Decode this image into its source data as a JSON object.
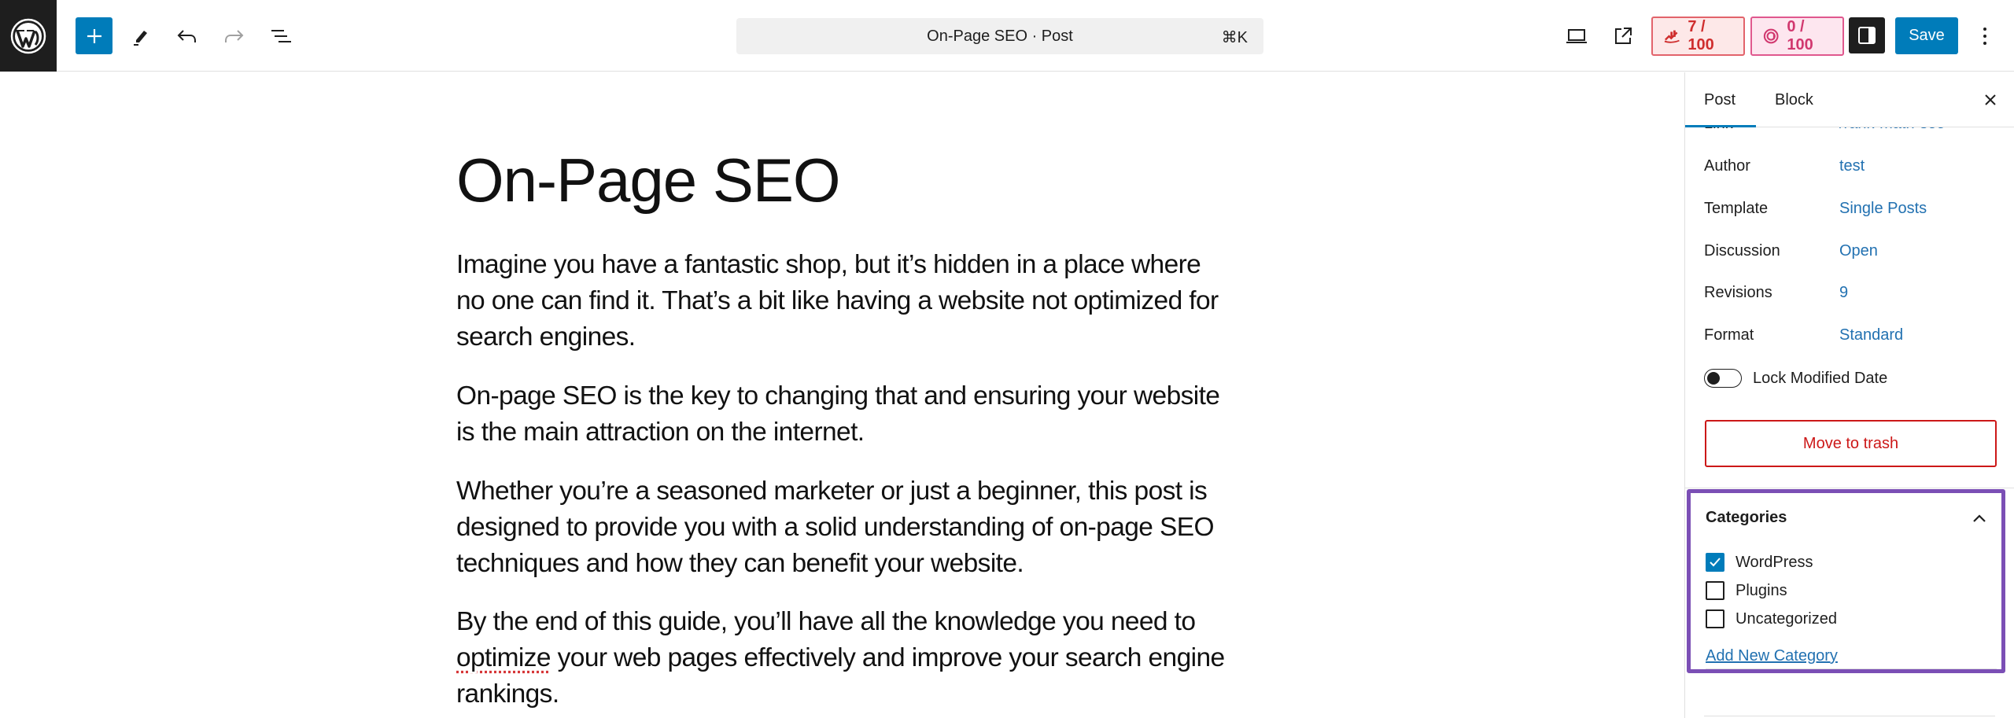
{
  "toolbar": {
    "command_bar_label": "On-Page SEO · Post",
    "command_shortcut": "⌘K",
    "seo_score": "7 / 100",
    "ai_score": "0 / 100",
    "save_label": "Save",
    "icons": {
      "logo": "wordpress-logo-icon",
      "inserter": "plus-icon",
      "tools": "pencil-icon",
      "undo": "undo-icon",
      "redo": "redo-icon",
      "outline": "list-view-icon",
      "view": "laptop-icon",
      "preview": "external-link-icon",
      "seo": "rank-math-icon",
      "ai": "content-ai-icon",
      "settings": "sidebar-toggle-icon",
      "more": "vertical-ellipsis-icon"
    }
  },
  "colors": {
    "accent": "#007cba",
    "link": "#2271b1",
    "danger": "#cc1818",
    "highlight_border": "#7b4fb5"
  },
  "editor": {
    "title": "On-Page SEO",
    "paragraphs": {
      "p1": "Imagine you have a fantastic shop, but it’s hidden in a place where no one can find it. That’s a bit like having a website not optimized for search engines.",
      "p2": "On-page SEO is the key to changing that and ensuring your website is the main attraction on the internet.",
      "p3": "Whether you’re a seasoned marketer or just a beginner, this post is designed to provide you with a solid understanding of on-page SEO techniques and how they can benefit your website.",
      "p4_before": "By the end of this guide, you’ll have all the knowledge you need to ",
      "p4_misspelled": "optimize",
      "p4_after": " your web pages effectively and improve your search engine rankings."
    }
  },
  "sidebar": {
    "tabs": {
      "post": "Post",
      "block": "Block"
    },
    "link": {
      "label": "Link",
      "value": "/rank-math-seo"
    },
    "meta": {
      "author": {
        "label": "Author",
        "value": "test"
      },
      "template": {
        "label": "Template",
        "value": "Single Posts"
      },
      "discussion": {
        "label": "Discussion",
        "value": "Open"
      },
      "revisions": {
        "label": "Revisions",
        "value": "9"
      },
      "format": {
        "label": "Format",
        "value": "Standard"
      }
    },
    "lock_modified_date": {
      "label": "Lock Modified Date",
      "enabled": false
    },
    "trash_label": "Move to trash",
    "categories": {
      "title": "Categories",
      "items": [
        {
          "label": "WordPress",
          "checked": true
        },
        {
          "label": "Plugins",
          "checked": false
        },
        {
          "label": "Uncategorized",
          "checked": false
        }
      ],
      "add_new_label": "Add New Category"
    }
  }
}
